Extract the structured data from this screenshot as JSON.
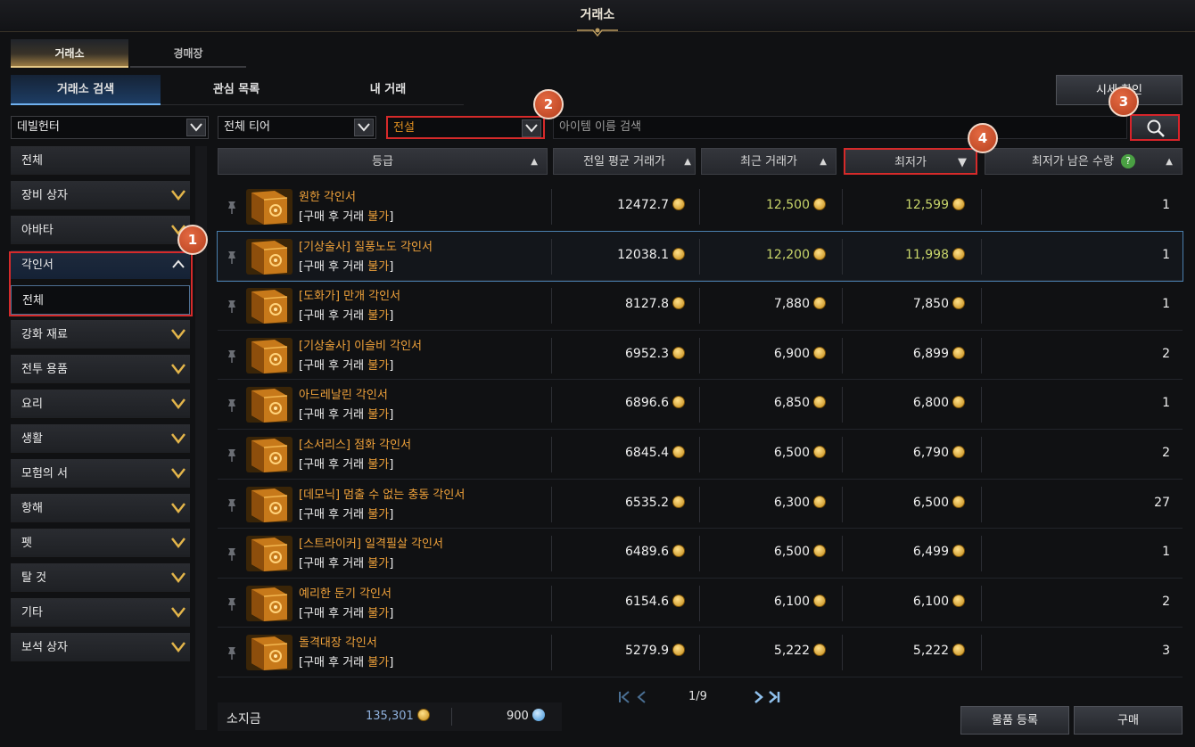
{
  "window": {
    "title": "거래소"
  },
  "main_tabs": [
    {
      "label": "거래소"
    },
    {
      "label": "경매장"
    }
  ],
  "sub_tabs": [
    {
      "label": "거래소 검색"
    },
    {
      "label": "관심 목록"
    },
    {
      "label": "내 거래"
    }
  ],
  "price_button": {
    "label": "시세 확인"
  },
  "filters": {
    "class": "데빌헌터",
    "tier": "전체 티어",
    "grade": "전설",
    "search_placeholder": "아이템 이름 검색"
  },
  "sidebar": {
    "items": [
      {
        "label": "전체"
      },
      {
        "label": "장비 상자"
      },
      {
        "label": "아바타"
      },
      {
        "label": "각인서"
      },
      {
        "label": "전체"
      },
      {
        "label": "강화 재료"
      },
      {
        "label": "전투 용품"
      },
      {
        "label": "요리"
      },
      {
        "label": "생활"
      },
      {
        "label": "모험의 서"
      },
      {
        "label": "항해"
      },
      {
        "label": "펫"
      },
      {
        "label": "탈 것"
      },
      {
        "label": "기타"
      },
      {
        "label": "보석 상자"
      }
    ]
  },
  "table": {
    "headers": {
      "grade": "등급",
      "avg": "전일 평균 거래가",
      "recent": "최근 거래가",
      "lowest": "최저가",
      "remaining": "최저가 남은 수량"
    },
    "trade_prefix": "[구매 후 거래 ",
    "trade_status": "불가",
    "trade_suffix": "]",
    "rows": [
      {
        "name": "원한 각인서",
        "avg": "12472.7",
        "recent": "12,500",
        "lowest": "12,599",
        "qty": "1"
      },
      {
        "name": "[기상술사] 질풍노도 각인서",
        "avg": "12038.1",
        "recent": "12,200",
        "lowest": "11,998",
        "qty": "1"
      },
      {
        "name": "[도화가] 만개 각인서",
        "avg": "8127.8",
        "recent": "7,880",
        "lowest": "7,850",
        "qty": "1"
      },
      {
        "name": "[기상술사] 이슬비 각인서",
        "avg": "6952.3",
        "recent": "6,900",
        "lowest": "6,899",
        "qty": "2"
      },
      {
        "name": "아드레날린 각인서",
        "avg": "6896.6",
        "recent": "6,850",
        "lowest": "6,800",
        "qty": "1"
      },
      {
        "name": "[소서리스] 점화 각인서",
        "avg": "6845.4",
        "recent": "6,500",
        "lowest": "6,790",
        "qty": "2"
      },
      {
        "name": "[데모닉] 멈출 수 없는 충동 각인서",
        "avg": "6535.2",
        "recent": "6,300",
        "lowest": "6,500",
        "qty": "27"
      },
      {
        "name": "[스트라이커] 일격필살 각인서",
        "avg": "6489.6",
        "recent": "6,500",
        "lowest": "6,499",
        "qty": "1"
      },
      {
        "name": "예리한 둔기 각인서",
        "avg": "6154.6",
        "recent": "6,100",
        "lowest": "6,100",
        "qty": "2"
      },
      {
        "name": "돌격대장 각인서",
        "avg": "5279.9",
        "recent": "5,222",
        "lowest": "5,222",
        "qty": "3"
      }
    ]
  },
  "pagination": {
    "label": "1/9"
  },
  "balance": {
    "label": "소지금",
    "gold": "135,301",
    "crystal": "900"
  },
  "actions": {
    "register": "물품 등록",
    "buy": "구매"
  },
  "annotations": {
    "one": "1",
    "two": "2",
    "three": "3",
    "four": "4"
  },
  "colors": {
    "accent_gold": "#e5c887",
    "item_orange": "#f0a23a",
    "price_green": "#c9d66b",
    "highlight_red": "#d62a2a",
    "selected_blue": "#4a7fae"
  },
  "icons": {
    "search": "search-icon",
    "pin": "pin-icon",
    "book": "engraving-book-icon",
    "gold": "gold-coin-icon",
    "crystal": "blue-crystal-icon"
  }
}
